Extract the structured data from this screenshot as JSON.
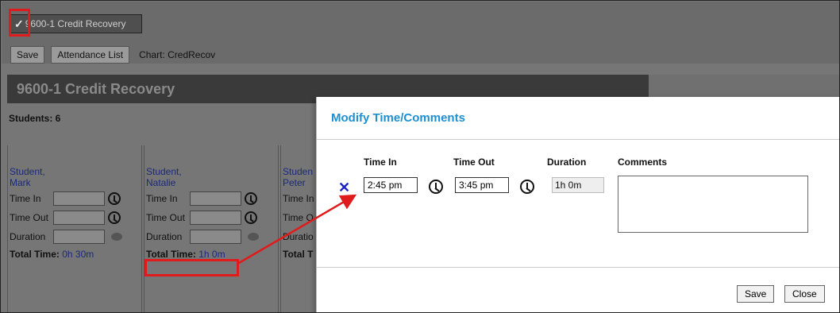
{
  "top": {
    "tab_label": "9600-1 Credit Recovery",
    "save_label": "Save",
    "attendance_label": "Attendance List",
    "chart_label": "Chart: CredRecov"
  },
  "course": {
    "title": "9600-1 Credit Recovery",
    "students_label": "Students: 6"
  },
  "cards": [
    {
      "last": "Student,",
      "first": "Mark",
      "total_value": "0h 30m"
    },
    {
      "last": "Student,",
      "first": "Natalie",
      "total_value": "1h 0m"
    },
    {
      "last": "Studen",
      "first": "Peter",
      "total_value": ""
    }
  ],
  "labels": {
    "time_in": "Time In",
    "time_out": "Time Out",
    "duration": "Duration",
    "total_time": "Total Time:"
  },
  "partial_labels": {
    "time_in": "Time In",
    "time_out": "Time O",
    "duration": "Duratio",
    "total_time": "Total T"
  },
  "modal": {
    "title": "Modify Time/Comments",
    "col_time_in": "Time In",
    "col_time_out": "Time Out",
    "col_duration": "Duration",
    "col_comments": "Comments",
    "time_in_value": "2:45 pm",
    "time_out_value": "3:45 pm",
    "duration_value": "1h 0m",
    "comments_value": "",
    "save_label": "Save",
    "close_label": "Close"
  },
  "colors": {
    "accent": "#1f8fd0",
    "highlight": "#e01b1b",
    "link": "#1b2a7a",
    "delete": "#1a22c8"
  }
}
